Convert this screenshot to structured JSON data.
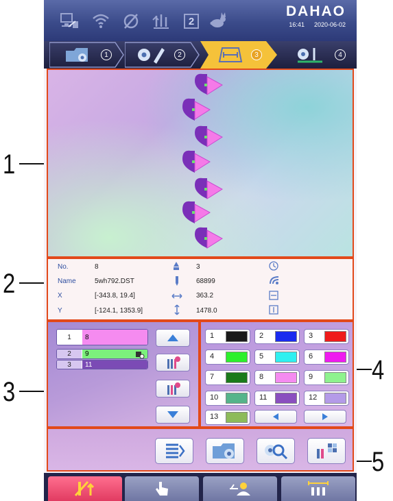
{
  "status": {
    "brand": "DAHAO",
    "time": "16:41",
    "date": "2020-06-02",
    "head_number": "2"
  },
  "steps": [
    {
      "num": "1",
      "icon": "folder-flower-icon"
    },
    {
      "num": "2",
      "icon": "flower-pencil-icon"
    },
    {
      "num": "3",
      "icon": "frame-measure-icon"
    },
    {
      "num": "4",
      "icon": "flower-needle-icon"
    }
  ],
  "info": {
    "no_label": "No.",
    "no_value": "8",
    "name_label": "Name",
    "name_value": "5wh792.DST",
    "x_label": "X",
    "x_value": "[-343.8, 19.4]",
    "y_label": "Y",
    "y_value": "[-124.1, 1353.9]",
    "colors_value": "3",
    "stitches_value": "68899",
    "width_value": "363.2",
    "height_value": "1478.0"
  },
  "color_sequence": [
    {
      "index": "1",
      "value": "8",
      "color": "#f58bf0"
    },
    {
      "index": "2",
      "value": "9",
      "color": "#7cf07c"
    },
    {
      "index": "3",
      "value": "11",
      "color": "#7b4bb5"
    }
  ],
  "palette": [
    {
      "num": "1",
      "color": "#1a1a1a"
    },
    {
      "num": "2",
      "color": "#1a2bef"
    },
    {
      "num": "3",
      "color": "#ef1b1b"
    },
    {
      "num": "4",
      "color": "#2cf02c"
    },
    {
      "num": "5",
      "color": "#2ff0f0"
    },
    {
      "num": "6",
      "color": "#ef1bef"
    },
    {
      "num": "7",
      "color": "#1a7a1a"
    },
    {
      "num": "8",
      "color": "#f58bf0"
    },
    {
      "num": "9",
      "color": "#8ef28e"
    },
    {
      "num": "10",
      "color": "#55b48a"
    },
    {
      "num": "11",
      "color": "#8a4fbf"
    },
    {
      "num": "12",
      "color": "#b49be8"
    },
    {
      "num": "13",
      "color": "#8dbb5a"
    }
  ],
  "callouts": [
    "1",
    "2",
    "3",
    "4",
    "5"
  ],
  "colors": {
    "accent_orange": "#e2491a",
    "active_tab": "#e13b61"
  }
}
